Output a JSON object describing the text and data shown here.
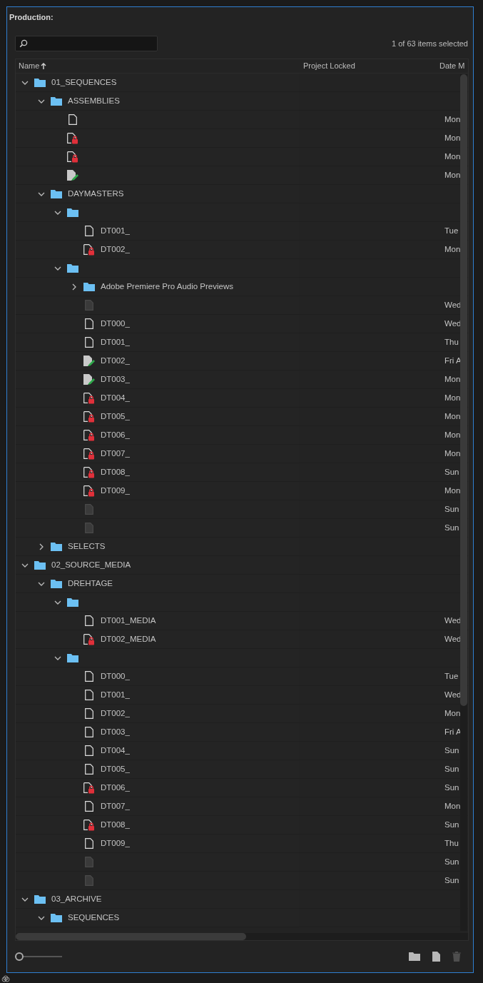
{
  "panel": {
    "title": "Production:"
  },
  "selection_count": "1 of 63 items selected",
  "columns": [
    "Name",
    "Project Locked",
    "Date M"
  ],
  "tree": [
    {
      "kind": "folder",
      "name": "01_SEQUENCES",
      "expanded": true,
      "children": [
        {
          "kind": "folder",
          "name": "ASSEMBLIES",
          "expanded": true,
          "children": [
            {
              "kind": "sequence",
              "date": "Mon"
            },
            {
              "kind": "locked",
              "date": "Mon"
            },
            {
              "kind": "locked",
              "date": "Mon"
            },
            {
              "kind": "editing",
              "date": "Mon"
            }
          ]
        },
        {
          "kind": "folder",
          "name": "DAYMASTERS",
          "expanded": true,
          "children": [
            {
              "kind": "folder",
              "expanded": true,
              "children": [
                {
                  "kind": "sequence",
                  "name": "DT001_",
                  "date": "Tue"
                },
                {
                  "kind": "locked",
                  "name": "DT002_",
                  "date": "Mon"
                }
              ]
            },
            {
              "kind": "folder",
              "expanded": true,
              "children": [
                {
                  "kind": "folder",
                  "name": "Adobe Premiere Pro Audio Previews",
                  "expanded": false
                },
                {
                  "kind": "offline",
                  "date": "Wed"
                },
                {
                  "kind": "sequence",
                  "name": "DT000_",
                  "date": "Wed"
                },
                {
                  "kind": "sequence",
                  "name": "DT001_",
                  "date": "Thu"
                },
                {
                  "kind": "editing",
                  "name": "DT002_",
                  "date": "Fri A"
                },
                {
                  "kind": "editing",
                  "name": "DT003_",
                  "date": "Mon"
                },
                {
                  "kind": "locked",
                  "name": "DT004_",
                  "date": "Mon"
                },
                {
                  "kind": "locked",
                  "name": "DT005_",
                  "date": "Mon"
                },
                {
                  "kind": "locked",
                  "name": "DT006_",
                  "date": "Mon"
                },
                {
                  "kind": "locked",
                  "name": "DT007_",
                  "date": "Mon"
                },
                {
                  "kind": "locked",
                  "name": "DT008_",
                  "date": "Sun"
                },
                {
                  "kind": "locked",
                  "name": "DT009_",
                  "date": "Mon"
                },
                {
                  "kind": "offline",
                  "date": "Sun"
                },
                {
                  "kind": "offline",
                  "date": "Sun"
                }
              ]
            }
          ]
        },
        {
          "kind": "folder",
          "name": "SELECTS",
          "expanded": false
        }
      ]
    },
    {
      "kind": "folder",
      "name": "02_SOURCE_MEDIA",
      "expanded": true,
      "children": [
        {
          "kind": "folder",
          "name": "DREHTAGE",
          "expanded": true,
          "children": [
            {
              "kind": "folder",
              "expanded": true,
              "children": [
                {
                  "kind": "sequence",
                  "name": "DT001_MEDIA",
                  "date": "Wed"
                },
                {
                  "kind": "locked",
                  "name": "DT002_MEDIA",
                  "date": "Wed"
                }
              ]
            },
            {
              "kind": "folder",
              "expanded": true,
              "children": [
                {
                  "kind": "sequence",
                  "name": "DT000_",
                  "date": "Tue"
                },
                {
                  "kind": "sequence",
                  "name": "DT001_",
                  "date": "Wed"
                },
                {
                  "kind": "sequence",
                  "name": "DT002_",
                  "date": "Mon"
                },
                {
                  "kind": "sequence",
                  "name": "DT003_",
                  "date": "Fri A"
                },
                {
                  "kind": "sequence",
                  "name": "DT004_",
                  "date": "Sun"
                },
                {
                  "kind": "sequence",
                  "name": "DT005_",
                  "date": "Sun"
                },
                {
                  "kind": "locked",
                  "name": "DT006_",
                  "date": "Sun"
                },
                {
                  "kind": "sequence",
                  "name": "DT007_",
                  "date": "Mon"
                },
                {
                  "kind": "locked",
                  "name": "DT008_",
                  "date": "Sun"
                },
                {
                  "kind": "sequence",
                  "name": "DT009_",
                  "date": "Thu"
                },
                {
                  "kind": "offline",
                  "date": "Sun"
                },
                {
                  "kind": "offline",
                  "date": "Sun"
                }
              ]
            }
          ]
        }
      ]
    },
    {
      "kind": "folder",
      "name": "03_ARCHIVE",
      "expanded": true,
      "children": [
        {
          "kind": "folder",
          "name": "SEQUENCES",
          "expanded": true
        }
      ]
    }
  ],
  "zoom_slider": {
    "level": 0
  },
  "buttons": [
    {
      "kind": "folder",
      "disabled": false
    },
    {
      "kind": "item",
      "disabled": false
    },
    {
      "kind": "trash",
      "disabled": true
    }
  ]
}
